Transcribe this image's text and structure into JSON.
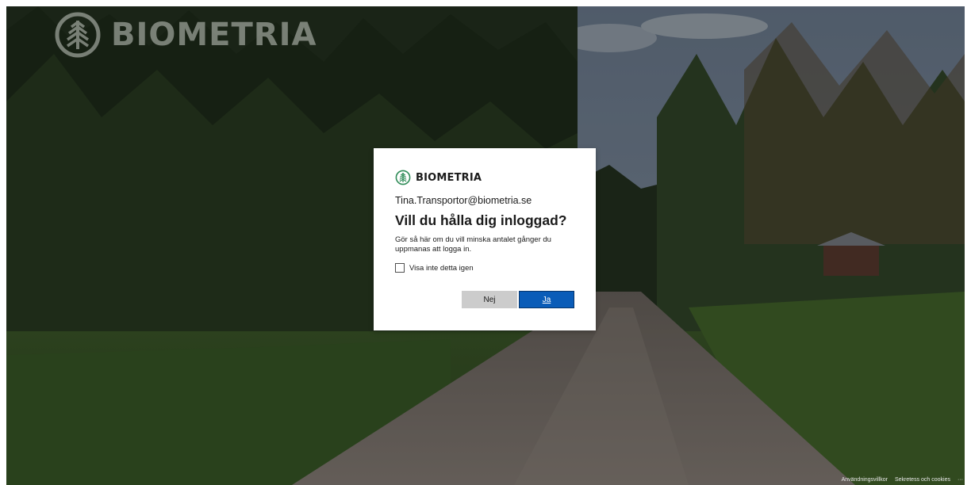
{
  "background": {
    "logo_text": "BIOMETRIA"
  },
  "dialog": {
    "brand_text": "BIOMETRIA",
    "identity": "Tina.Transportor@biometria.se",
    "title": "Vill du hålla dig inloggad?",
    "description": "Gör så här om du vill minska antalet gånger du uppmanas att logga in.",
    "checkbox_label": "Visa inte detta igen",
    "checkbox_checked": false,
    "no_label": "Nej",
    "yes_label": "Ja"
  },
  "footer": {
    "terms": "Användningsvillkor",
    "privacy": "Sekretess och cookies",
    "more": "···"
  },
  "colors": {
    "primary_button": "#0a5cb8",
    "secondary_button": "#cccccc",
    "dialog_bg": "#ffffff"
  }
}
